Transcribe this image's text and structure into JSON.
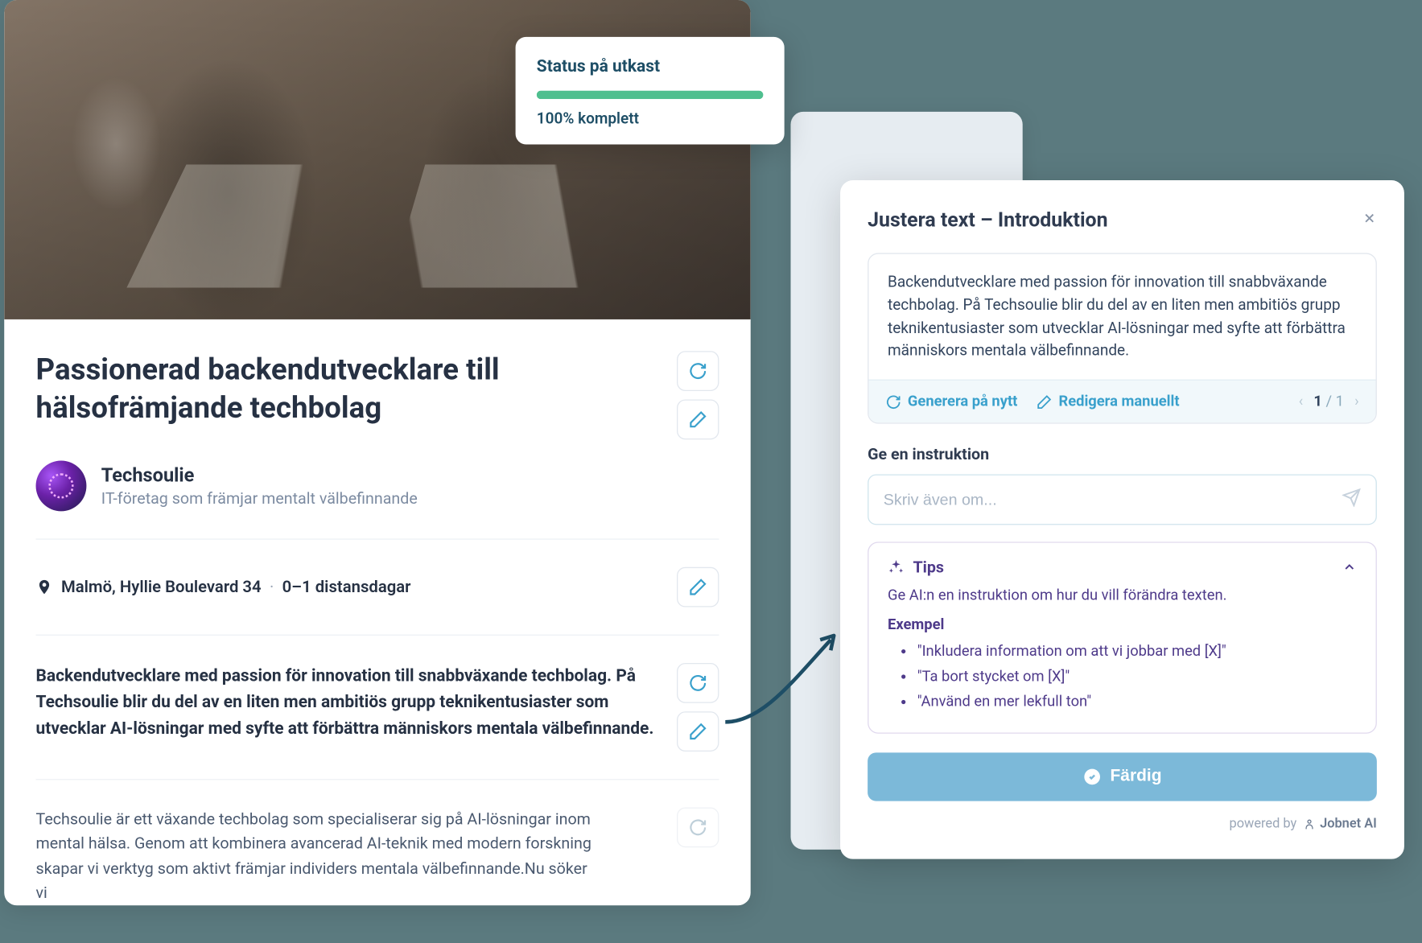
{
  "statusCard": {
    "title": "Status på utkast",
    "percent": 100,
    "percentLabel": "100% komplett"
  },
  "job": {
    "title": "Passionerad backendutvecklare till hälsofrämjande techbolag",
    "company": {
      "name": "Techsoulie",
      "tagline": "IT-företag som främjar mentalt välbefinnande"
    },
    "location": {
      "city": "Malmö, Hyllie Boulevard 34",
      "remote": "0–1 distansdagar"
    },
    "intro": "Backendutvecklare med passion för innovation till snabbväxande techbolag. På Techsoulie blir du del av en liten men ambitiös grupp teknikentusiaster som utvecklar AI-lösningar med syfte att förbättra människors mentala välbefinnande.",
    "description": "Techsoulie är ett växande techbolag som specialiserar sig på AI-lösningar inom mental hälsa. Genom att kombinera avancerad AI-teknik med modern forskning skapar vi verktyg som aktivt främjar individers mentala välbefinnande.Nu söker vi"
  },
  "aiPanel": {
    "title": "Justera text – Introduktion",
    "generatedText": "Backendutvecklare med passion för innovation till snabbväxande techbolag. På Techsoulie blir du del av en liten men ambitiös grupp teknikentusiaster som utvecklar AI-lösningar med syfte att förbättra människors mentala välbefinnande.",
    "regenerateLabel": "Generera på nytt",
    "editLabel": "Redigera manuellt",
    "pager": {
      "current": "1",
      "total": "1"
    },
    "instructionLabel": "Ge en instruktion",
    "inputPlaceholder": "Skriv även om...",
    "tips": {
      "title": "Tips",
      "body": "Ge AI:n en instruktion om hur du vill förändra texten.",
      "examplesLabel": "Exempel",
      "examples": [
        "\"Inkludera information om att vi jobbar med [X]\"",
        "\"Ta bort stycket om [X]\"",
        "\"Använd en mer lekfull ton\""
      ]
    },
    "doneLabel": "Färdig",
    "poweredByPrefix": "powered by",
    "poweredByBrand": "Jobnet AI"
  }
}
